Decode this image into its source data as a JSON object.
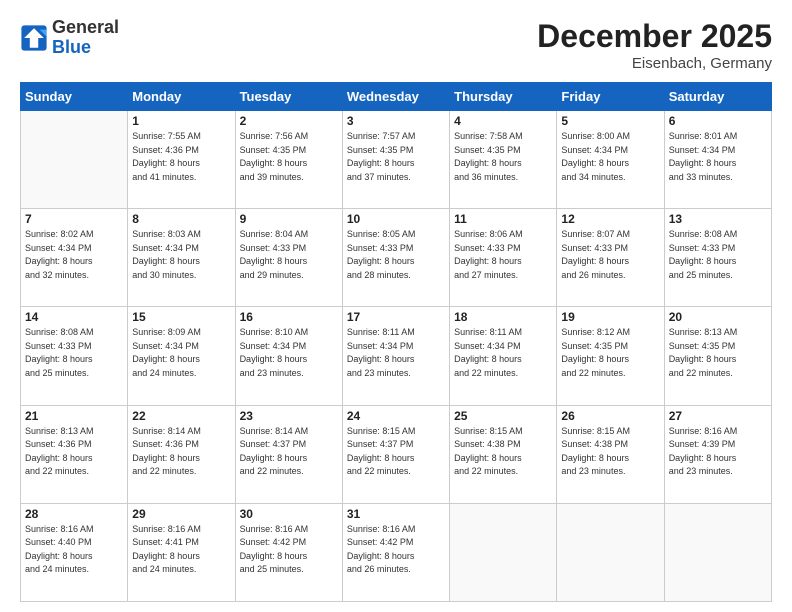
{
  "logo": {
    "general": "General",
    "blue": "Blue"
  },
  "title": {
    "month_year": "December 2025",
    "location": "Eisenbach, Germany"
  },
  "weekdays": [
    "Sunday",
    "Monday",
    "Tuesday",
    "Wednesday",
    "Thursday",
    "Friday",
    "Saturday"
  ],
  "weeks": [
    [
      {
        "day": "",
        "info": ""
      },
      {
        "day": "1",
        "info": "Sunrise: 7:55 AM\nSunset: 4:36 PM\nDaylight: 8 hours\nand 41 minutes."
      },
      {
        "day": "2",
        "info": "Sunrise: 7:56 AM\nSunset: 4:35 PM\nDaylight: 8 hours\nand 39 minutes."
      },
      {
        "day": "3",
        "info": "Sunrise: 7:57 AM\nSunset: 4:35 PM\nDaylight: 8 hours\nand 37 minutes."
      },
      {
        "day": "4",
        "info": "Sunrise: 7:58 AM\nSunset: 4:35 PM\nDaylight: 8 hours\nand 36 minutes."
      },
      {
        "day": "5",
        "info": "Sunrise: 8:00 AM\nSunset: 4:34 PM\nDaylight: 8 hours\nand 34 minutes."
      },
      {
        "day": "6",
        "info": "Sunrise: 8:01 AM\nSunset: 4:34 PM\nDaylight: 8 hours\nand 33 minutes."
      }
    ],
    [
      {
        "day": "7",
        "info": "Sunrise: 8:02 AM\nSunset: 4:34 PM\nDaylight: 8 hours\nand 32 minutes."
      },
      {
        "day": "8",
        "info": "Sunrise: 8:03 AM\nSunset: 4:34 PM\nDaylight: 8 hours\nand 30 minutes."
      },
      {
        "day": "9",
        "info": "Sunrise: 8:04 AM\nSunset: 4:33 PM\nDaylight: 8 hours\nand 29 minutes."
      },
      {
        "day": "10",
        "info": "Sunrise: 8:05 AM\nSunset: 4:33 PM\nDaylight: 8 hours\nand 28 minutes."
      },
      {
        "day": "11",
        "info": "Sunrise: 8:06 AM\nSunset: 4:33 PM\nDaylight: 8 hours\nand 27 minutes."
      },
      {
        "day": "12",
        "info": "Sunrise: 8:07 AM\nSunset: 4:33 PM\nDaylight: 8 hours\nand 26 minutes."
      },
      {
        "day": "13",
        "info": "Sunrise: 8:08 AM\nSunset: 4:33 PM\nDaylight: 8 hours\nand 25 minutes."
      }
    ],
    [
      {
        "day": "14",
        "info": "Sunrise: 8:08 AM\nSunset: 4:33 PM\nDaylight: 8 hours\nand 25 minutes."
      },
      {
        "day": "15",
        "info": "Sunrise: 8:09 AM\nSunset: 4:34 PM\nDaylight: 8 hours\nand 24 minutes."
      },
      {
        "day": "16",
        "info": "Sunrise: 8:10 AM\nSunset: 4:34 PM\nDaylight: 8 hours\nand 23 minutes."
      },
      {
        "day": "17",
        "info": "Sunrise: 8:11 AM\nSunset: 4:34 PM\nDaylight: 8 hours\nand 23 minutes."
      },
      {
        "day": "18",
        "info": "Sunrise: 8:11 AM\nSunset: 4:34 PM\nDaylight: 8 hours\nand 22 minutes."
      },
      {
        "day": "19",
        "info": "Sunrise: 8:12 AM\nSunset: 4:35 PM\nDaylight: 8 hours\nand 22 minutes."
      },
      {
        "day": "20",
        "info": "Sunrise: 8:13 AM\nSunset: 4:35 PM\nDaylight: 8 hours\nand 22 minutes."
      }
    ],
    [
      {
        "day": "21",
        "info": "Sunrise: 8:13 AM\nSunset: 4:36 PM\nDaylight: 8 hours\nand 22 minutes."
      },
      {
        "day": "22",
        "info": "Sunrise: 8:14 AM\nSunset: 4:36 PM\nDaylight: 8 hours\nand 22 minutes."
      },
      {
        "day": "23",
        "info": "Sunrise: 8:14 AM\nSunset: 4:37 PM\nDaylight: 8 hours\nand 22 minutes."
      },
      {
        "day": "24",
        "info": "Sunrise: 8:15 AM\nSunset: 4:37 PM\nDaylight: 8 hours\nand 22 minutes."
      },
      {
        "day": "25",
        "info": "Sunrise: 8:15 AM\nSunset: 4:38 PM\nDaylight: 8 hours\nand 22 minutes."
      },
      {
        "day": "26",
        "info": "Sunrise: 8:15 AM\nSunset: 4:38 PM\nDaylight: 8 hours\nand 23 minutes."
      },
      {
        "day": "27",
        "info": "Sunrise: 8:16 AM\nSunset: 4:39 PM\nDaylight: 8 hours\nand 23 minutes."
      }
    ],
    [
      {
        "day": "28",
        "info": "Sunrise: 8:16 AM\nSunset: 4:40 PM\nDaylight: 8 hours\nand 24 minutes."
      },
      {
        "day": "29",
        "info": "Sunrise: 8:16 AM\nSunset: 4:41 PM\nDaylight: 8 hours\nand 24 minutes."
      },
      {
        "day": "30",
        "info": "Sunrise: 8:16 AM\nSunset: 4:42 PM\nDaylight: 8 hours\nand 25 minutes."
      },
      {
        "day": "31",
        "info": "Sunrise: 8:16 AM\nSunset: 4:42 PM\nDaylight: 8 hours\nand 26 minutes."
      },
      {
        "day": "",
        "info": ""
      },
      {
        "day": "",
        "info": ""
      },
      {
        "day": "",
        "info": ""
      }
    ]
  ]
}
